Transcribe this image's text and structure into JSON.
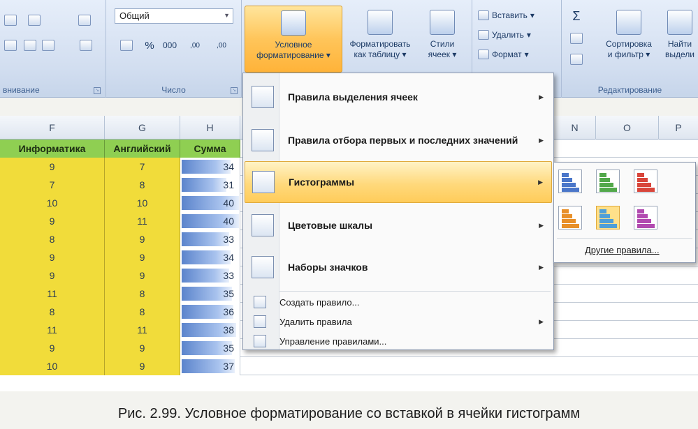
{
  "ribbon": {
    "alignment_group_label": "внивание",
    "number_group_label": "Число",
    "number_format_value": "Общий",
    "percent_symbol": "%",
    "thousands_symbol": "000",
    "dec_inc": ",00",
    "dec_dec": ",00",
    "styles": {
      "conditional_formatting_line1": "Условное",
      "conditional_formatting_line2": "форматирование",
      "format_as_table_line1": "Форматировать",
      "format_as_table_line2": "как таблицу",
      "cell_styles_line1": "Стили",
      "cell_styles_line2": "ячеек"
    },
    "cells": {
      "insert": "Вставить",
      "delete": "Удалить",
      "format": "Формат"
    },
    "editing": {
      "sort_filter_line1": "Сортировка",
      "sort_filter_line2": "и фильтр",
      "find_line1": "Найти",
      "find_line2": "выдели",
      "group_label": "Редактирование",
      "sigma": "Σ"
    }
  },
  "sheet": {
    "columns": [
      "F",
      "G",
      "H",
      "N",
      "O",
      "P"
    ],
    "headers": [
      "Информатика",
      "Английский",
      "Сумма"
    ],
    "rows": [
      [
        "9",
        "7",
        "34"
      ],
      [
        "7",
        "8",
        "31"
      ],
      [
        "10",
        "10",
        "40"
      ],
      [
        "9",
        "11",
        "40"
      ],
      [
        "8",
        "9",
        "33"
      ],
      [
        "9",
        "9",
        "34"
      ],
      [
        "9",
        "9",
        "33"
      ],
      [
        "11",
        "8",
        "35"
      ],
      [
        "8",
        "8",
        "36"
      ],
      [
        "11",
        "11",
        "38"
      ],
      [
        "9",
        "9",
        "35"
      ],
      [
        "10",
        "9",
        "37"
      ]
    ],
    "sum_scale_max": 40
  },
  "menu": {
    "items": [
      {
        "label": "Правила выделения ячеек",
        "underline": "П"
      },
      {
        "label": "Правила отбора первых и последних значений",
        "underline": "П"
      },
      {
        "label": "Гистограммы",
        "underline": "Г"
      },
      {
        "label": "Цветовые шкалы",
        "underline": "Ц"
      },
      {
        "label": "Наборы значков",
        "underline": "Н"
      }
    ],
    "small_items": [
      {
        "label": "Создать правило..."
      },
      {
        "label": "Удалить правила"
      },
      {
        "label": "Управление правилами..."
      }
    ]
  },
  "submenu": {
    "more_rules": "Другие правила...",
    "bar_colors": [
      "#4a76c9",
      "#52a84a",
      "#d8453a",
      "#e8902a",
      "#4f9fd8",
      "#b24ab0"
    ]
  },
  "caption": "Рис. 2.99. Условное форматирование со вставкой в ячейки гистограмм"
}
